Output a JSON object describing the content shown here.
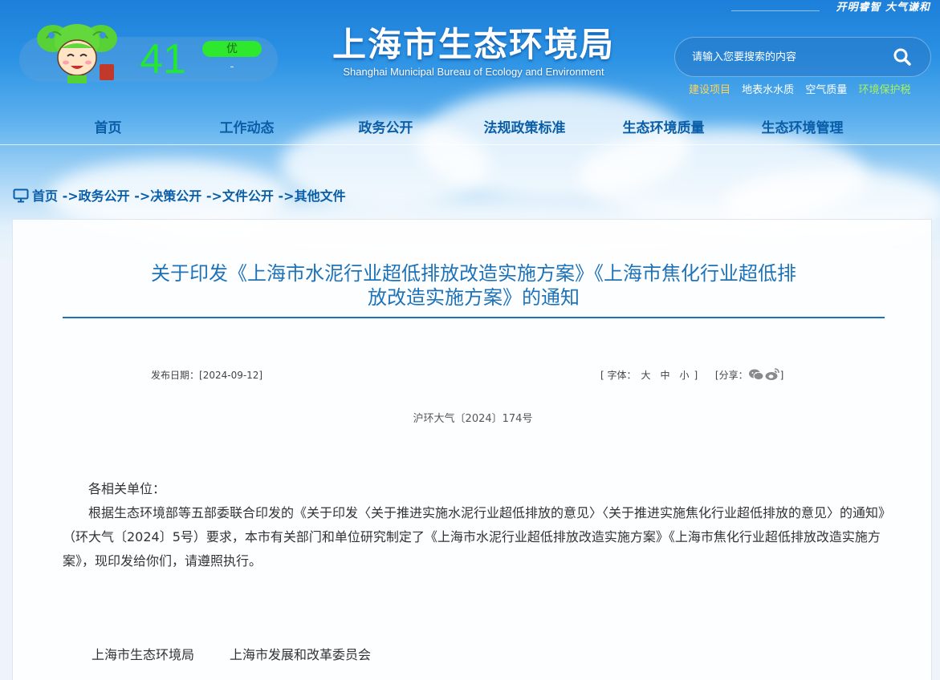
{
  "header": {
    "slogan": "开明睿智  大气谦和",
    "site_title": "上海市生态环境局",
    "site_subtitle": "Shanghai Municipal Bureau of Ecology and Environment"
  },
  "aqi": {
    "value": "41",
    "level": "优",
    "pollutant": "-"
  },
  "search": {
    "placeholder": "请输入您要搜索的内容"
  },
  "quick_links": [
    {
      "label": "建设项目",
      "color": "#ffd45a"
    },
    {
      "label": "地表水水质",
      "color": "#ffffff"
    },
    {
      "label": "空气质量",
      "color": "#ffffff"
    },
    {
      "label": "环境保护税",
      "color": "#a8f25a"
    }
  ],
  "nav": [
    "首页",
    "工作动态",
    "政务公开",
    "法规政策标准",
    "生态环境质量",
    "生态环境管理"
  ],
  "breadcrumb": {
    "items": [
      "首页",
      "政务公开",
      "决策公开",
      "文件公开",
      "其他文件"
    ],
    "separator": " ->"
  },
  "article": {
    "title_line1": "关于印发《上海市水泥行业超低排放改造实施方案》《上海市焦化行业超低排",
    "title_line2": "放改造实施方案》的通知",
    "date_label": "发布日期：",
    "date_value": "[2024-09-12]",
    "font_label": "[ 字体：",
    "font_large": "大",
    "font_medium": "中",
    "font_small": "小",
    "font_close": "]",
    "share_label": "[分享：",
    "share_close": "]",
    "doc_number": "沪环大气〔2024〕174号",
    "salutation": "各相关单位：",
    "paragraph": "根据生态环境部等五部委联合印发的《关于印发〈关于推进实施水泥行业超低排放的意见〉〈关于推进实施焦化行业超低排放的意见〉的通知》（环大气〔2024〕5号）要求，本市有关部门和单位研究制定了《上海市水泥行业超低排放改造实施方案》《上海市焦化行业超低排放改造实施方案》，现印发给你们，请遵照执行。",
    "signatures": [
      "上海市生态环境局",
      "上海市发展和改革委员会"
    ]
  },
  "colors": {
    "link_blue": "#0a5ea8",
    "title_blue": "#1e73b8",
    "aqi_green": "#22e82e"
  }
}
